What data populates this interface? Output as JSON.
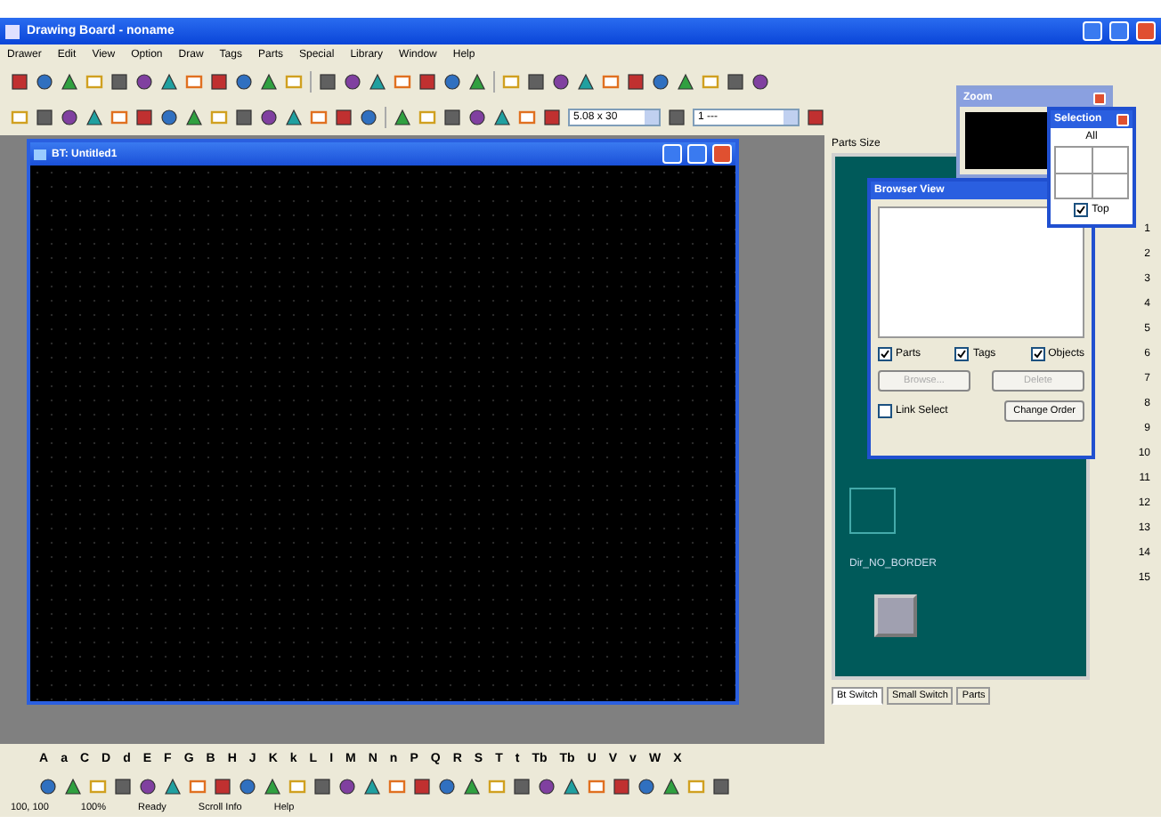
{
  "window": {
    "title": "Drawing Board - noname"
  },
  "menu": [
    "Drawer",
    "Edit",
    "View",
    "Option",
    "Draw",
    "Tags",
    "Parts",
    "Special",
    "Library",
    "Window",
    "Help"
  ],
  "toolbar": {
    "grid_combo": "5.08 x 30",
    "layer_combo": "1 ---"
  },
  "document": {
    "title": "BT: Untitled1"
  },
  "parts_panel": {
    "label": "Parts Size",
    "numbers": [
      "1",
      "2",
      "3",
      "4",
      "5",
      "6",
      "7",
      "8",
      "9",
      "10",
      "11",
      "12",
      "13",
      "14",
      "15"
    ],
    "part_name": "Dir_NO_BORDER",
    "tabs": [
      {
        "label": "Bt Switch",
        "selected": true
      },
      {
        "label": "Small Switch",
        "selected": false
      },
      {
        "label": "Parts",
        "selected": false
      }
    ]
  },
  "zoom_window": {
    "title": "Zoom"
  },
  "selection_window": {
    "title": "Selection",
    "all_label": "All",
    "top": {
      "label": "Top",
      "checked": true
    }
  },
  "browser_view": {
    "title": "Browser View",
    "checkboxes": [
      {
        "label": "Parts",
        "checked": true
      },
      {
        "label": "Tags",
        "checked": true
      },
      {
        "label": "Objects",
        "checked": true
      }
    ],
    "buttons": [
      {
        "label": "Browse...",
        "disabled": true
      },
      {
        "label": "Delete",
        "disabled": true
      }
    ],
    "link_select": {
      "label": "Link Select",
      "checked": false
    },
    "change_order": "Change Order"
  },
  "letter_palette": [
    "A",
    "a",
    "C",
    "D",
    "d",
    "E",
    "F",
    "G",
    "B",
    "H",
    "J",
    "K",
    "k",
    "L",
    "I",
    "M",
    "N",
    "n",
    "P",
    "Q",
    "R",
    "S",
    "T",
    "t",
    "Tb",
    "Tb",
    "U",
    "V",
    "v",
    "W",
    "X"
  ],
  "status_bar": [
    "100, 100",
    "100%",
    "Ready",
    "Scroll Info",
    "Help"
  ]
}
